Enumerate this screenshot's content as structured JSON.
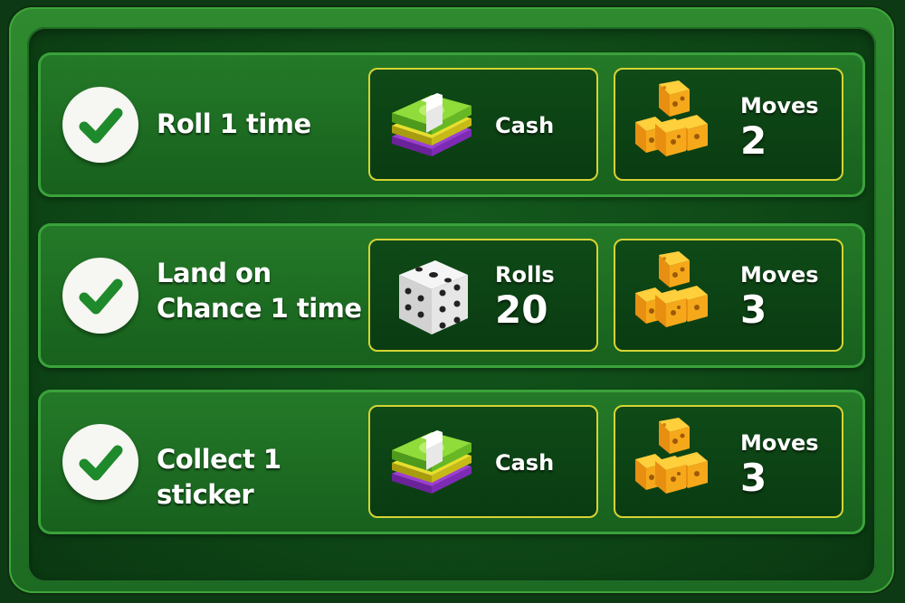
{
  "quests": [
    {
      "label": "Roll 1 time",
      "completed": true,
      "rewards": [
        {
          "name": "Cash",
          "count": "",
          "icon": "cash-stack-icon"
        },
        {
          "name": "Moves",
          "count": "2",
          "icon": "cheese-cubes-icon"
        }
      ]
    },
    {
      "label": "Land on Chance 1 time",
      "completed": true,
      "rewards": [
        {
          "name": "Rolls",
          "count": "20",
          "icon": "dice-icon"
        },
        {
          "name": "Moves",
          "count": "3",
          "icon": "cheese-cubes-icon"
        }
      ]
    },
    {
      "label": "Collect 1 sticker",
      "completed": true,
      "rewards": [
        {
          "name": "Cash",
          "count": "",
          "icon": "cash-stack-icon"
        },
        {
          "name": "Moves",
          "count": "3",
          "icon": "cheese-cubes-icon"
        }
      ]
    }
  ],
  "colors": {
    "panel_green": "#247a28",
    "border_green": "#3aa23b",
    "reward_border": "#d6d434",
    "check_green": "#1f8a2c"
  }
}
